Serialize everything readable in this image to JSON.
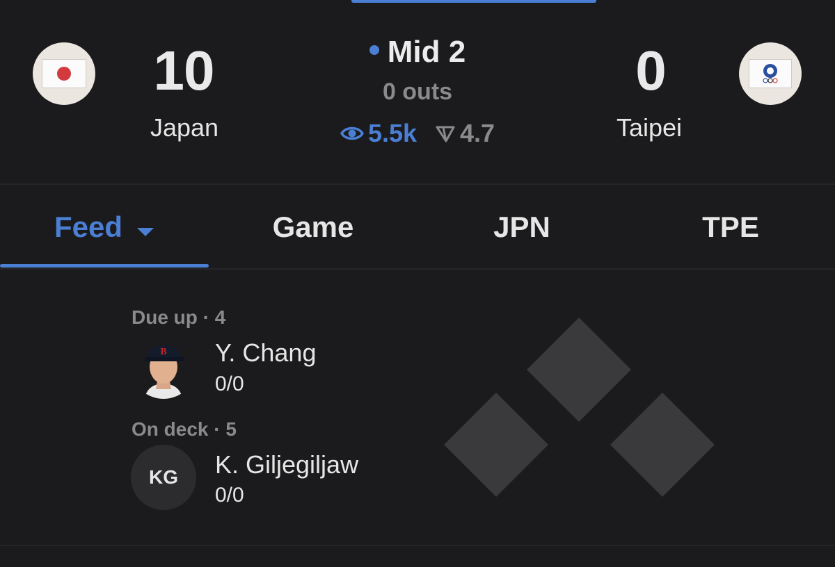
{
  "game": {
    "home": {
      "score": "10",
      "name": "Japan",
      "flag_icon": "japan-flag-icon"
    },
    "away": {
      "score": "0",
      "name": "Taipei",
      "flag_icon": "chinese-taipei-flag-icon"
    },
    "inning": "Mid 2",
    "outs": "0 outs",
    "viewers": "5.5k",
    "rating": "4.7",
    "accent_color": "#4a7fd4"
  },
  "tabs": [
    {
      "label": "Feed",
      "active": true
    },
    {
      "label": "Game",
      "active": false
    },
    {
      "label": "JPN",
      "active": false
    },
    {
      "label": "TPE",
      "active": false
    }
  ],
  "due_up": {
    "label": "Due up · 4",
    "name": "Y. Chang",
    "stat": "0/0"
  },
  "on_deck": {
    "label": "On deck · 5",
    "initials": "KG",
    "name": "K. Giljegiljaw",
    "stat": "0/0"
  }
}
